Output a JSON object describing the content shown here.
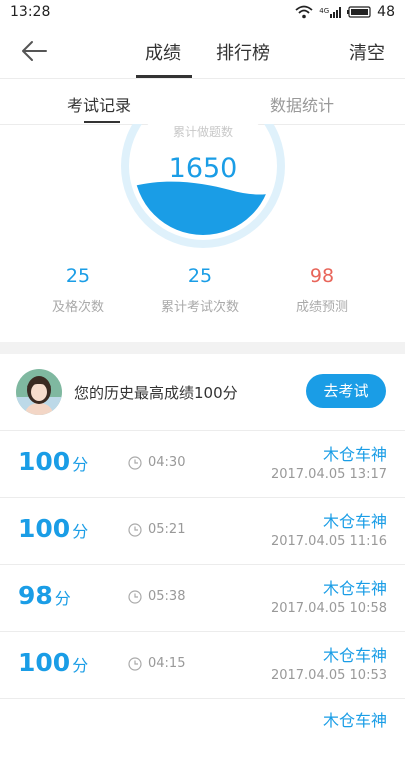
{
  "status_bar": {
    "time": "13:28",
    "network": "4G",
    "battery": "48"
  },
  "header": {
    "tabs": [
      "成绩",
      "排行榜"
    ],
    "clear_label": "清空"
  },
  "sub_tabs": {
    "records": "考试记录",
    "stats": "数据统计"
  },
  "gauge": {
    "label": "累计做题数",
    "value": "1650"
  },
  "stats": [
    {
      "value": "25",
      "label": "及格次数",
      "color": "#1a9de6"
    },
    {
      "value": "25",
      "label": "累计考试次数",
      "color": "#1a9de6"
    },
    {
      "value": "98",
      "label": "成绩预测",
      "color": "#e8655a"
    }
  ],
  "best": {
    "text": "您的历史最高成绩100分",
    "button_label": "去考试"
  },
  "score_unit": "分",
  "records": [
    {
      "score": "100",
      "duration": "04:30",
      "user": "木仓车神",
      "date": "2017.04.05  13:17"
    },
    {
      "score": "100",
      "duration": "05:21",
      "user": "木仓车神",
      "date": "2017.04.05  11:16"
    },
    {
      "score": "98",
      "duration": "05:38",
      "user": "木仓车神",
      "date": "2017.04.05  10:58"
    },
    {
      "score": "100",
      "duration": "04:15",
      "user": "木仓车神",
      "date": "2017.04.05  10:53"
    },
    {
      "score": "",
      "duration": "",
      "user": "木仓车神",
      "date": ""
    }
  ],
  "colors": {
    "accent": "#1a9de6",
    "predict": "#e8655a"
  }
}
